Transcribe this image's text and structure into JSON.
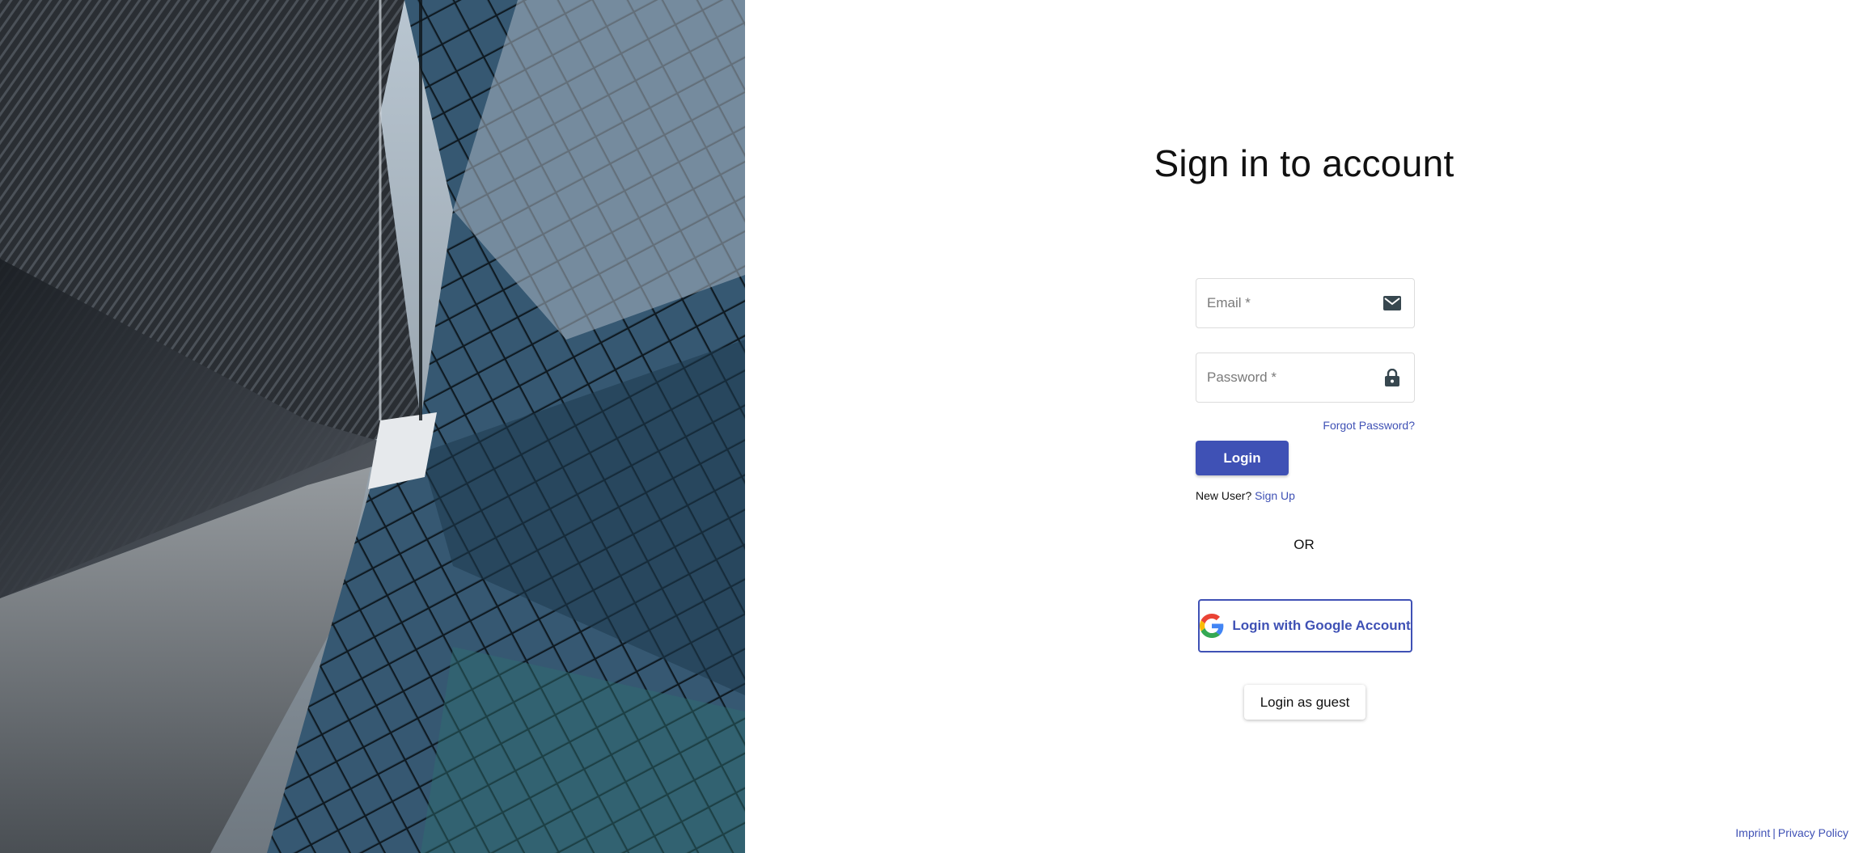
{
  "page": {
    "title": "Sign in to account"
  },
  "hero": {
    "image_subject": "modern glass skyscrapers viewed from below"
  },
  "form": {
    "email_placeholder": "Email *",
    "email_value": "",
    "email_icon": "mail-icon",
    "password_placeholder": "Password *",
    "password_value": "",
    "password_icon": "lock-icon",
    "forgot_password": "Forgot Password?",
    "login_label": "Login",
    "new_user_prefix": "New User?",
    "sign_up_link": "Sign Up"
  },
  "divider": {
    "or_text": "OR"
  },
  "social": {
    "google_label": "Login with Google Account",
    "google_icon": "google-icon"
  },
  "guest": {
    "label": "Login as guest"
  },
  "footer": {
    "imprint": "Imprint",
    "separator": "|",
    "privacy": "Privacy Policy"
  },
  "colors": {
    "accent": "#3f51b5",
    "icon_dark": "#37474f",
    "border": "#dcdcdc"
  }
}
